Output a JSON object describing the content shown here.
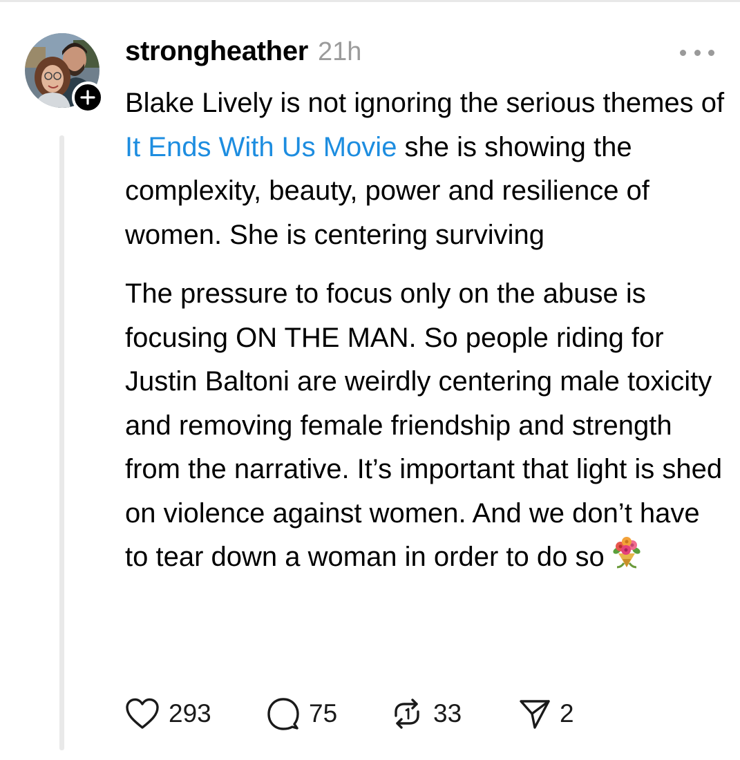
{
  "post": {
    "username": "strongheather",
    "time": "21h",
    "paragraph1": {
      "before": "Blake Lively is not ignoring the serious themes of ",
      "link": "It Ends With Us Movie",
      "after": " she is showing the complexity, beauty, power and resilience of women. She is centering surviving"
    },
    "paragraph2": "The pressure to focus only on the abuse is focusing ON THE MAN. So people riding for Justin Baltoni are weirdly centering male toxicity and removing female friendship and strength from the narrative. It’s important that light is shed on violence against women. And we don’t have to tear down a woman in order to do so",
    "emoji": "bouquet-emoji"
  },
  "actions": {
    "likes": "293",
    "replies": "75",
    "reposts": "33",
    "shares": "2"
  },
  "icons": {
    "like": "heart-icon",
    "reply": "comment-bubble-icon",
    "repost": "repost-arrows-icon",
    "share": "paper-plane-icon",
    "more": "more-dots-icon",
    "follow": "plus-icon"
  },
  "colors": {
    "link": "#1d8de0",
    "meta": "#9b9b9b",
    "thread_line": "#e9e9e9"
  }
}
